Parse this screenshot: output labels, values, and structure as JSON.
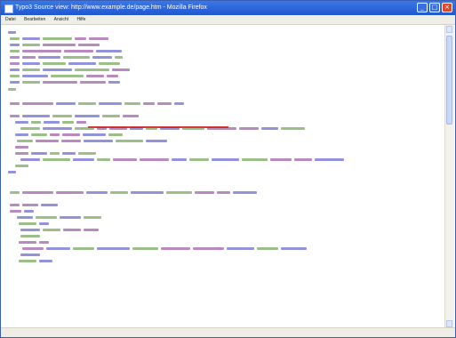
{
  "window": {
    "title": "Typo3 Source view: http://www.example.de/page.htm - Mozilla Firefox"
  },
  "menu": [
    "Datei",
    "Bearbeiten",
    "Ansicht",
    "Hilfe"
  ],
  "colors": {
    "tag": "#7f2a8a",
    "attr": "#3a3ac0",
    "value": "#4a8a2a",
    "text": "#444444",
    "comment": "#999999",
    "highlight": "#d43a3a"
  },
  "icons": {
    "app": "page-icon",
    "minimize": "minimize-icon",
    "maximize": "maximize-icon",
    "close": "close-icon"
  }
}
